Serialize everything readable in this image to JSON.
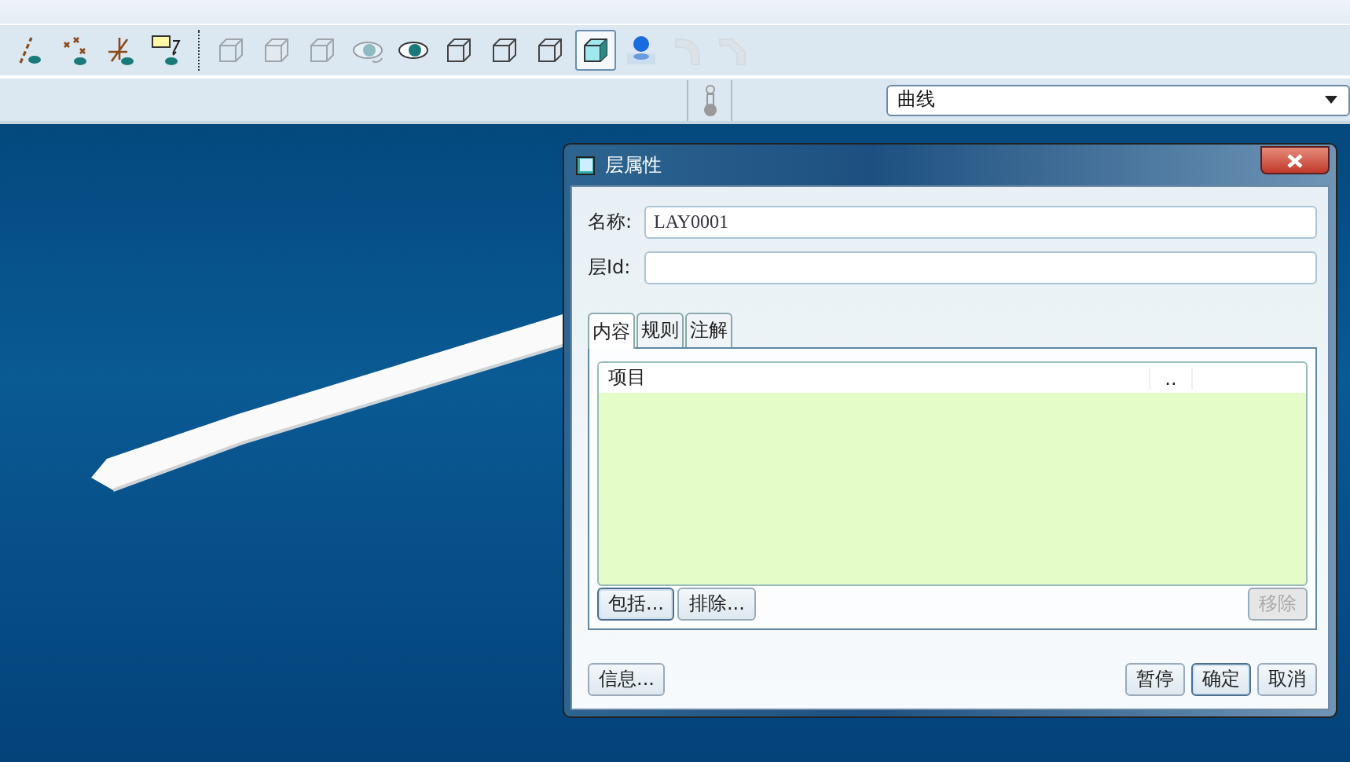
{
  "toolbar": {
    "tools": [
      {
        "kind": "axis-eye",
        "selected": false,
        "disabled": false
      },
      {
        "kind": "points-eye",
        "selected": false,
        "disabled": false
      },
      {
        "kind": "csys-eye",
        "selected": false,
        "disabled": false
      },
      {
        "kind": "note-eye",
        "selected": false,
        "disabled": false
      },
      {
        "kind": "cube-faint",
        "selected": false,
        "disabled": true
      },
      {
        "kind": "cube-hidden",
        "selected": false,
        "disabled": true
      },
      {
        "kind": "cube-front",
        "selected": false,
        "disabled": true
      },
      {
        "kind": "eye-rotate",
        "selected": false,
        "disabled": true
      },
      {
        "kind": "eye",
        "selected": false,
        "disabled": false
      },
      {
        "kind": "wire-cube",
        "selected": false,
        "disabled": false
      },
      {
        "kind": "hidden-cube",
        "selected": false,
        "disabled": false
      },
      {
        "kind": "no-hidden-cube",
        "selected": false,
        "disabled": false
      },
      {
        "kind": "shaded-cube",
        "selected": true,
        "disabled": false
      },
      {
        "kind": "pin",
        "selected": false,
        "disabled": false
      },
      {
        "kind": "round-edge",
        "selected": false,
        "disabled": true
      },
      {
        "kind": "chamfer-edge",
        "selected": false,
        "disabled": true
      }
    ]
  },
  "filter": {
    "value": "曲线"
  },
  "dialog": {
    "title": "层属性",
    "fields": [
      {
        "label": "名称:",
        "value": "LAY0001"
      },
      {
        "label": "层Id:"
      }
    ],
    "tabs": [
      {
        "label": "内容",
        "selected": true
      },
      {
        "label": "规则",
        "selected": false
      },
      {
        "label": "注解",
        "selected": false
      }
    ],
    "table": {
      "columns": [
        "项目",
        ".."
      ]
    },
    "list_buttons": [
      {
        "label": "包括...",
        "disabled": false,
        "focused": true
      },
      {
        "label": "排除...",
        "disabled": false,
        "focused": false
      },
      {
        "label": "移除",
        "disabled": true,
        "focused": false
      }
    ],
    "buttons": [
      {
        "label": "信息...",
        "focused": false
      },
      {
        "label": "暂停",
        "focused": false
      },
      {
        "label": "确定",
        "focused": true
      },
      {
        "label": "取消",
        "focused": false
      }
    ]
  }
}
